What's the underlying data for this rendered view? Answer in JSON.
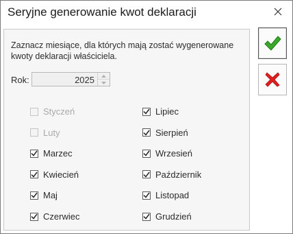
{
  "window": {
    "title": "Seryjne generowanie kwot deklaracji"
  },
  "instruction": "Zaznacz miesiące, dla których mają zostać wygenerowane kwoty deklaracji właściciela.",
  "year": {
    "label": "Rok:",
    "value": "2025"
  },
  "months_left": [
    {
      "label": "Styczeń",
      "checked": false,
      "disabled": true
    },
    {
      "label": "Luty",
      "checked": false,
      "disabled": true
    },
    {
      "label": "Marzec",
      "checked": true,
      "disabled": false
    },
    {
      "label": "Kwiecień",
      "checked": true,
      "disabled": false
    },
    {
      "label": "Maj",
      "checked": true,
      "disabled": false
    },
    {
      "label": "Czerwiec",
      "checked": true,
      "disabled": false
    }
  ],
  "months_right": [
    {
      "label": "Lipiec",
      "checked": true,
      "disabled": false
    },
    {
      "label": "Sierpień",
      "checked": true,
      "disabled": false
    },
    {
      "label": "Wrzesień",
      "checked": true,
      "disabled": false
    },
    {
      "label": "Październik",
      "checked": true,
      "disabled": false
    },
    {
      "label": "Listopad",
      "checked": true,
      "disabled": false
    },
    {
      "label": "Grudzień",
      "checked": true,
      "disabled": false
    }
  ],
  "actions": {
    "confirm_icon": "green-checkmark-icon",
    "cancel_icon": "red-x-icon"
  },
  "colors": {
    "confirm": "#3aa82a",
    "cancel": "#e02020"
  }
}
